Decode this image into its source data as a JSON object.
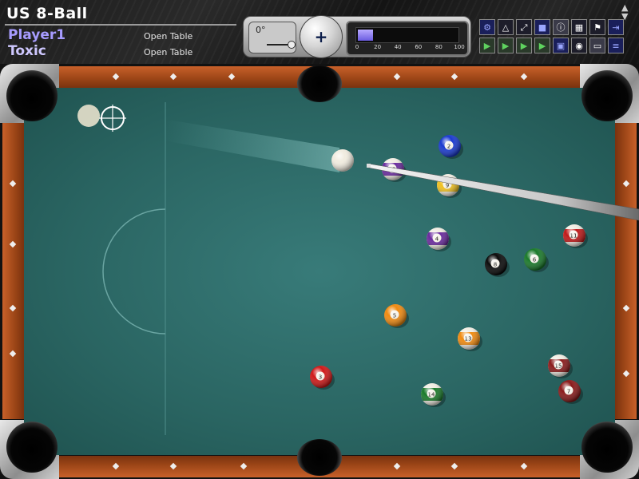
{
  "header": {
    "game_title": "US 8-Ball",
    "players": [
      {
        "name": "Player1",
        "status": "Open Table"
      },
      {
        "name": "Toxic",
        "status": "Open Table"
      }
    ]
  },
  "controls": {
    "angle_label": "0°",
    "cue_english_symbol": "+",
    "power_fraction": 0.15,
    "power_ticks": [
      "0",
      "20",
      "40",
      "60",
      "80",
      "100"
    ]
  },
  "toolbar": {
    "row1": [
      "settings-icon",
      "rack-triangle-icon",
      "fullscreen-icon",
      "table-cube-icon",
      "info-icon",
      "grid-icon",
      "flag-icon",
      "exit-icon"
    ],
    "row2": [
      "play-icon",
      "play-step-icon",
      "play-fast-icon",
      "play-end-icon",
      "save-icon",
      "replay-camera-icon",
      "replay-icon",
      "menu-list-icon"
    ]
  },
  "colors": {
    "felt": "#2a6562",
    "rail_wood": "#9a4416",
    "player1": "#a79cff",
    "player2": "#cfc8ff",
    "power_fill": "#8a7cff"
  },
  "balls": [
    {
      "num": 2,
      "color": "#1a3ad0",
      "stripe": false
    },
    {
      "num": 12,
      "color": "#6a2a9e",
      "stripe": true
    },
    {
      "num": 9,
      "color": "#f0c020",
      "stripe": true
    },
    {
      "num": 11,
      "color": "#c01818",
      "stripe": true
    },
    {
      "num": 4,
      "color": "#6a2a9e",
      "stripe": true
    },
    {
      "num": 8,
      "color": "#0a0a0a",
      "stripe": false
    },
    {
      "num": 6,
      "color": "#1a7a2a",
      "stripe": false
    },
    {
      "num": 5,
      "color": "#f08a10",
      "stripe": false
    },
    {
      "num": 13,
      "color": "#f08a10",
      "stripe": true
    },
    {
      "num": 3,
      "color": "#d01818",
      "stripe": false
    },
    {
      "num": 15,
      "color": "#8a1a1a",
      "stripe": true
    },
    {
      "num": 7,
      "color": "#8a1a1a",
      "stripe": false
    },
    {
      "num": 14,
      "color": "#1a7a2a",
      "stripe": true
    }
  ]
}
